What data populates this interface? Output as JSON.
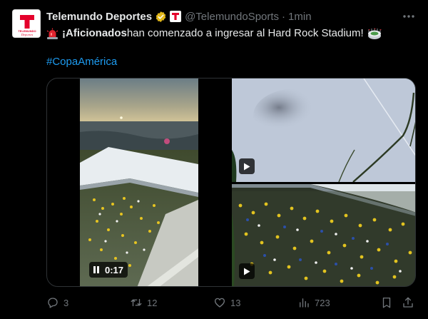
{
  "tweet": {
    "author_name": "Telemundo Deportes",
    "handle": "@TelemundoSports",
    "separator": "·",
    "time": "1min",
    "text_bold": "¡Aficionados",
    "text_rest": " han comenzado a ingresar al Hard Rock Stadium!",
    "hashtag": "#CopaAmérica",
    "avatar_text_top": "TELEMUNDO",
    "avatar_text_bottom": "Deportes",
    "affiliate_letter": "T"
  },
  "media": {
    "video_time": "0:17",
    "play_icon": "play-icon",
    "pause_icon": "pause-icon"
  },
  "actions": {
    "replies": "3",
    "retweets": "12",
    "likes": "13",
    "views": "723"
  },
  "colors": {
    "background": "#000000",
    "text": "#e7e9ea",
    "muted": "#71767b",
    "link": "#1d9bf0",
    "verified_gold": "#e2b719",
    "brand_red": "#e4002b"
  }
}
